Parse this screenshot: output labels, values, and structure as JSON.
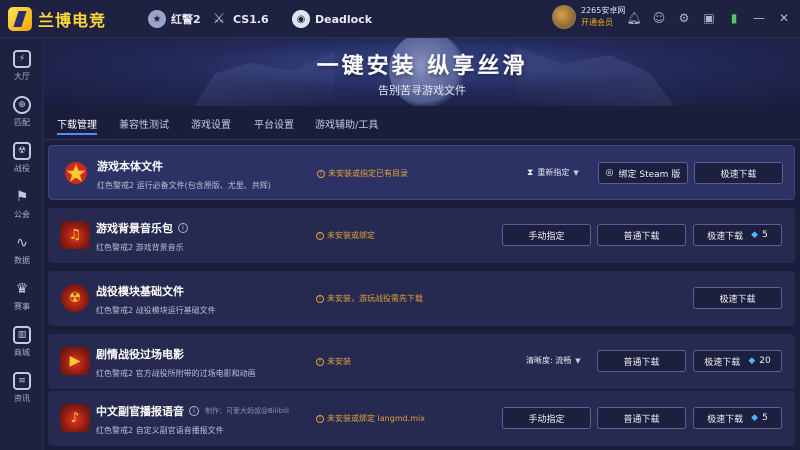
{
  "app": {
    "name": "兰博电竞"
  },
  "topbar": {
    "games": [
      {
        "label": "红警2",
        "icon": "red-alert-icon"
      },
      {
        "label": "CS1.6",
        "icon": "cs-soldier-icon"
      },
      {
        "label": "Deadlock",
        "icon": "deadlock-icon"
      }
    ],
    "user": {
      "name": "2265安卓网",
      "member": "开通会员"
    },
    "icons": [
      "bell-icon",
      "user-icon",
      "gear-icon",
      "box-icon",
      "signal-icon",
      "minimize-icon",
      "close-icon"
    ]
  },
  "sidebar": {
    "items": [
      {
        "label": "大厅",
        "icon": "lobby-icon"
      },
      {
        "label": "匹配",
        "icon": "match-icon"
      },
      {
        "label": "战役",
        "icon": "campaign-icon"
      },
      {
        "label": "公会",
        "icon": "guild-icon"
      },
      {
        "label": "数据",
        "icon": "data-icon"
      },
      {
        "label": "赛事",
        "icon": "trophy-icon"
      },
      {
        "label": "商城",
        "icon": "shop-icon"
      },
      {
        "label": "资讯",
        "icon": "news-icon"
      }
    ]
  },
  "banner": {
    "title": "一键安装  纵享丝滑",
    "subtitle": "告别苦寻游戏文件"
  },
  "tabs": [
    {
      "label": "下载管理",
      "active": true
    },
    {
      "label": "兼容性测试",
      "active": false
    },
    {
      "label": "游戏设置",
      "active": false
    },
    {
      "label": "平台设置",
      "active": false
    },
    {
      "label": "游戏辅助/工具",
      "active": false
    }
  ],
  "rows": [
    {
      "title": "游戏本体文件",
      "desc": "红色警戒2 运行必备文件(包含原版、尤里、共辉)",
      "status": "未安装或指定已有目录",
      "select": "重新指定",
      "steam_btn": "绑定 Steam 版",
      "fast_btn": "极速下载"
    },
    {
      "title": "游戏背景音乐包",
      "desc": "红色警戒2 游戏背景音乐",
      "status": "未安装或绑定",
      "manual_btn": "手动指定",
      "normal_btn": "普通下载",
      "fast_btn": "极速下载",
      "cost": "5"
    },
    {
      "title": "战役模块基础文件",
      "desc": "红色警戒2 战役模块运行基础文件",
      "status": "未安装，游玩战役需先下载",
      "fast_btn": "极速下载"
    },
    {
      "title": "剧情战役过场电影",
      "desc": "红色警戒2 官方战役所附带的过场电影和动画",
      "status": "未安装",
      "select": "清晰度: 流畅",
      "normal_btn": "普通下载",
      "fast_btn": "极速下载",
      "cost": "20"
    },
    {
      "title": "中文副官播报语音",
      "author": "制作：可爱大妈叔@Bilibili",
      "desc": "红色警戒2 自定义副官语音播报文件",
      "status": "未安装或绑定 langmd.mix",
      "manual_btn": "手动指定",
      "normal_btn": "普通下载",
      "fast_btn": "极速下载",
      "cost": "5"
    }
  ],
  "colors": {
    "accent": "#4f8cff",
    "warning": "#e0a23a",
    "gem": "#4fb4ff",
    "brand": "#ffd93a"
  }
}
